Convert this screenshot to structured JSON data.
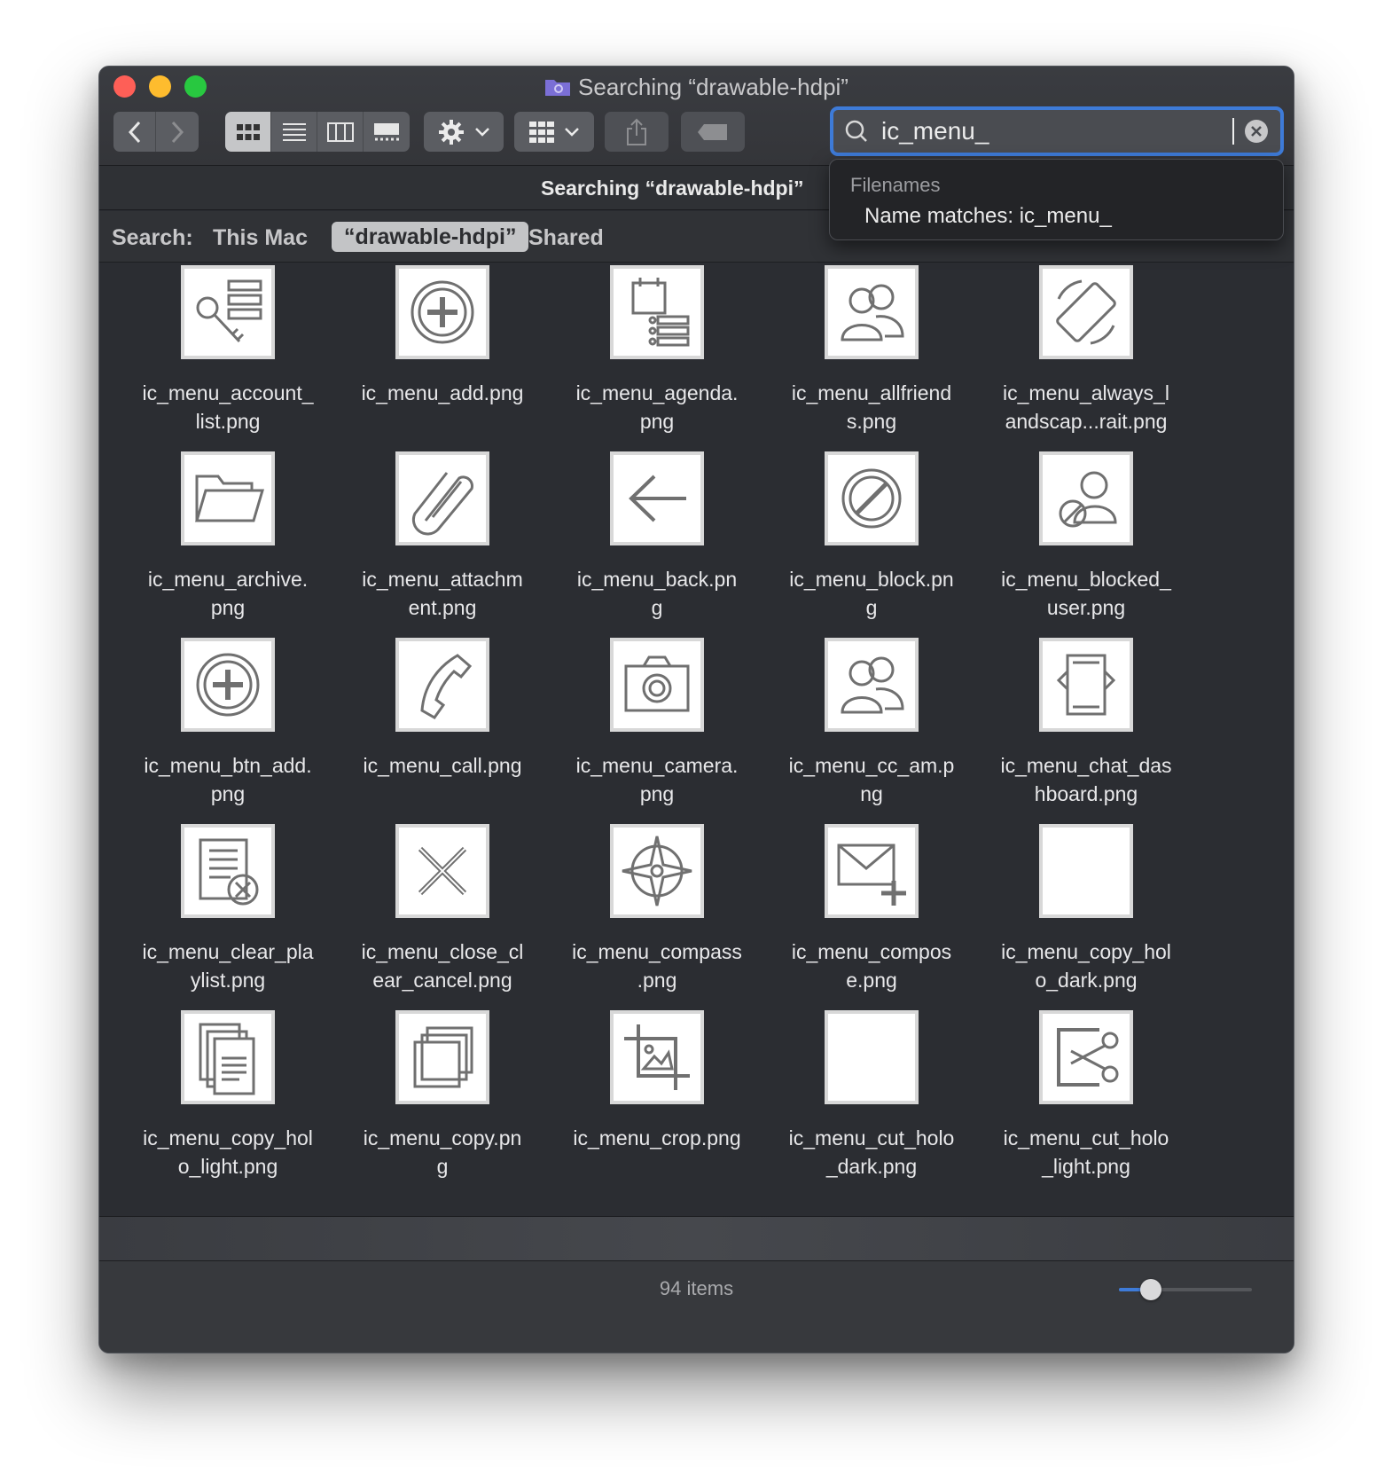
{
  "window": {
    "title": "Searching “drawable-hdpi”",
    "title_icon": "folder-icon"
  },
  "toolbar": {
    "back_icon": "chevron-left-icon",
    "forward_icon": "chevron-right-icon",
    "view_modes": [
      "icon-view",
      "list-view",
      "column-view",
      "gallery-view"
    ],
    "active_view": "icon-view",
    "action_icon": "gear-icon",
    "group_icon": "group-grid-icon",
    "share_icon": "share-icon",
    "tag_icon": "tag-icon"
  },
  "search": {
    "value": "ic_menu_",
    "icon": "search-icon",
    "clear_icon": "clear-icon"
  },
  "suggestions": {
    "header": "Filenames",
    "item": "Name matches: ic_menu_"
  },
  "pathbar": {
    "label": "Searching “drawable-hdpi”"
  },
  "scope": {
    "label": "Search:",
    "options": [
      "This Mac",
      "“drawable-hdpi”",
      "Shared"
    ],
    "selected": "“drawable-hdpi”"
  },
  "files": [
    {
      "name": "ic_menu_account_\nlist.png",
      "icon": "key-list-icon"
    },
    {
      "name": "ic_menu_add.png",
      "icon": "add-circle-icon"
    },
    {
      "name": "ic_menu_agenda.\npng",
      "icon": "agenda-icon"
    },
    {
      "name": "ic_menu_allfriend\ns.png",
      "icon": "people-icon"
    },
    {
      "name": "ic_menu_always_l\nandscap...rait.png",
      "icon": "rotate-icon"
    },
    {
      "name": "ic_menu_archive.\npng",
      "icon": "folder-icon"
    },
    {
      "name": "ic_menu_attachm\nent.png",
      "icon": "paperclip-icon"
    },
    {
      "name": "ic_menu_back.pn\ng",
      "icon": "arrow-left-icon"
    },
    {
      "name": "ic_menu_block.pn\ng",
      "icon": "block-icon"
    },
    {
      "name": "ic_menu_blocked_\nuser.png",
      "icon": "blocked-user-icon"
    },
    {
      "name": "ic_menu_btn_add.\npng",
      "icon": "add-circle-icon"
    },
    {
      "name": "ic_menu_call.png",
      "icon": "phone-icon"
    },
    {
      "name": "ic_menu_camera.\npng",
      "icon": "camera-icon"
    },
    {
      "name": "ic_menu_cc_am.p\nng",
      "icon": "people-icon"
    },
    {
      "name": "ic_menu_chat_das\nhboard.png",
      "icon": "chat-dashboard-icon"
    },
    {
      "name": "ic_menu_clear_pla\nylist.png",
      "icon": "clear-playlist-icon"
    },
    {
      "name": "ic_menu_close_cl\near_cancel.png",
      "icon": "close-icon"
    },
    {
      "name": "ic_menu_compass\n.png",
      "icon": "compass-icon"
    },
    {
      "name": "ic_menu_compos\ne.png",
      "icon": "compose-icon"
    },
    {
      "name": "ic_menu_copy_hol\no_dark.png",
      "icon": "blank-icon"
    },
    {
      "name": "ic_menu_copy_hol\no_light.png",
      "icon": "copy-doc-icon"
    },
    {
      "name": "ic_menu_copy.pn\ng",
      "icon": "copy-icon"
    },
    {
      "name": "ic_menu_crop.png",
      "icon": "crop-icon"
    },
    {
      "name": "ic_menu_cut_holo\n_dark.png",
      "icon": "blank-icon"
    },
    {
      "name": "ic_menu_cut_holo\n_light.png",
      "icon": "scissors-icon"
    }
  ],
  "status": {
    "item_count": "94 items",
    "icon_size_fraction": 0.24
  }
}
